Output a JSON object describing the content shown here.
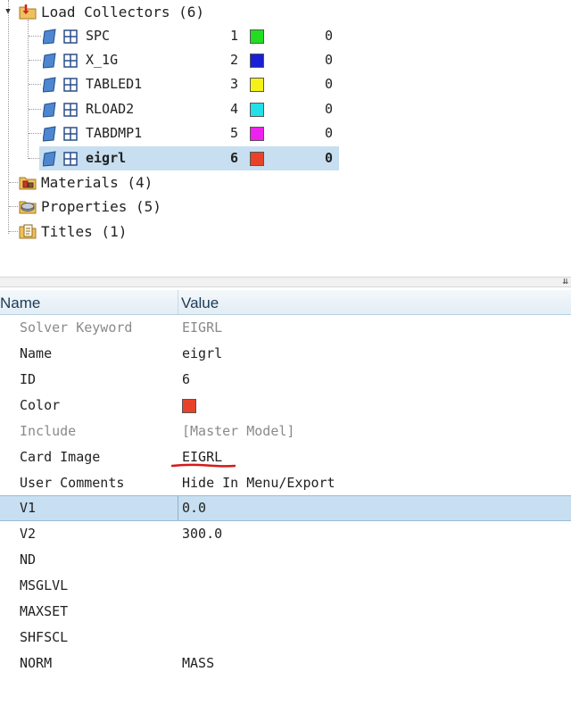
{
  "tree": {
    "load_collectors": {
      "label": "Load Collectors (6)",
      "items": [
        {
          "name": "SPC",
          "id": "1",
          "color": "#22dd22",
          "count": "0"
        },
        {
          "name": "X_1G",
          "id": "2",
          "color": "#1a1fd6",
          "count": "0"
        },
        {
          "name": "TABLED1",
          "id": "3",
          "color": "#f5f21a",
          "count": "0"
        },
        {
          "name": "RLOAD2",
          "id": "4",
          "color": "#22e0e8",
          "count": "0"
        },
        {
          "name": "TABDMP1",
          "id": "5",
          "color": "#ee22ee",
          "count": "0"
        },
        {
          "name": "eigrl",
          "id": "6",
          "color": "#e8432a",
          "count": "0"
        }
      ]
    },
    "materials": {
      "label": "Materials (4)"
    },
    "properties": {
      "label": "Properties (5)"
    },
    "titles": {
      "label": "Titles (1)"
    }
  },
  "grid": {
    "header_name": "Name",
    "header_value": "Value",
    "rows": [
      {
        "name": "Solver Keyword",
        "value": "EIGRL"
      },
      {
        "name": "Name",
        "value": "eigrl"
      },
      {
        "name": "ID",
        "value": "6"
      },
      {
        "name": "Color",
        "value": "",
        "swatch": "#e8432a"
      },
      {
        "name": "Include",
        "value": "[Master Model]"
      },
      {
        "name": "Card Image",
        "value": "EIGRL"
      },
      {
        "name": "User Comments",
        "value": "Hide In Menu/Export"
      },
      {
        "name": "V1",
        "value": "0.0"
      },
      {
        "name": "V2",
        "value": "300.0"
      },
      {
        "name": "ND",
        "value": ""
      },
      {
        "name": "MSGLVL",
        "value": ""
      },
      {
        "name": "MAXSET",
        "value": ""
      },
      {
        "name": "SHFSCL",
        "value": ""
      },
      {
        "name": "NORM",
        "value": "MASS"
      }
    ]
  },
  "icons": {
    "collapse": "collapse-panel-icon",
    "load_collector": "load-collector-icon",
    "material": "material-icon",
    "property": "property-icon",
    "title": "title-icon",
    "collector_entity": "collector-entity-icon"
  },
  "colors": {
    "selection": "#c7dff0",
    "annotation": "#d41a1a"
  }
}
